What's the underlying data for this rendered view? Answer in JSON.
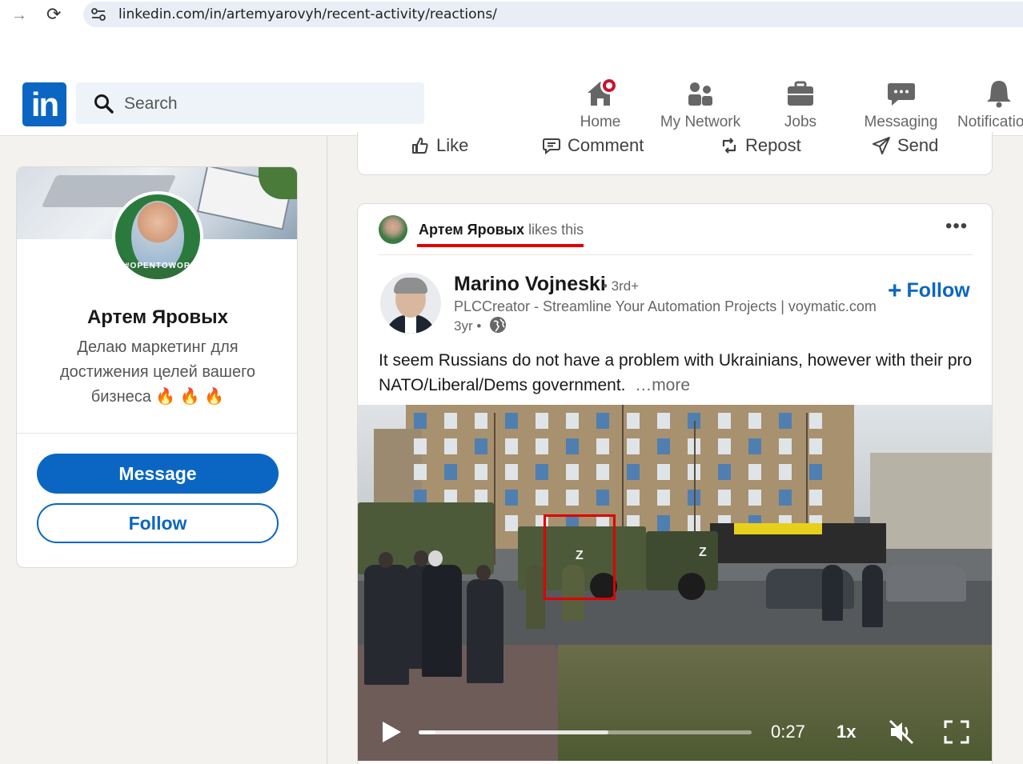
{
  "browser": {
    "url": "linkedin.com/in/artemyarovyh/recent-activity/reactions/"
  },
  "header": {
    "logo_text": "in",
    "search_placeholder": "Search",
    "nav": [
      {
        "label": "Home",
        "icon": "home-icon"
      },
      {
        "label": "My Network",
        "icon": "network-icon"
      },
      {
        "label": "Jobs",
        "icon": "briefcase-icon"
      },
      {
        "label": "Messaging",
        "icon": "chat-icon"
      },
      {
        "label": "Notifications",
        "icon": "bell-icon"
      }
    ]
  },
  "profile": {
    "name": "Артем Яровых",
    "headline": "Делаю маркетинг для достижения целей вашего бизнеса 🔥 🔥 🔥",
    "avatar_ring_text": "#OPENTOWORK",
    "message_label": "Message",
    "follow_label": "Follow"
  },
  "prev_post_actions": [
    {
      "label": "Like",
      "icon": "like-icon"
    },
    {
      "label": "Comment",
      "icon": "comment-icon"
    },
    {
      "label": "Repost",
      "icon": "repost-icon"
    },
    {
      "label": "Send",
      "icon": "send-icon"
    }
  ],
  "post": {
    "liker_name": "Артем Яровых",
    "liker_action": "likes this",
    "author": {
      "name": "Marino Vojneski",
      "degree": "• 3rd+",
      "headline": "PLCCreator - Streamline Your Automation Projects | voymatic.com",
      "time": "3yr •"
    },
    "follow_label": "Follow",
    "text": "It seem Russians do not have a problem with Ukrainians, however with their pro NATO/Liberal/Dems government.",
    "see_more": "…more",
    "video": {
      "time": "0:27",
      "speed": "1x",
      "progress": 0.05,
      "buffered": 0.57
    }
  },
  "colors": {
    "brand": "#0a66c2",
    "annotation_red": "#e00000",
    "notification": "#cb112d"
  }
}
